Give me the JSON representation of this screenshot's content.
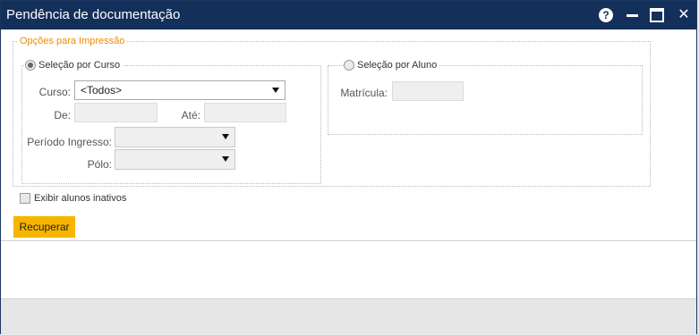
{
  "window": {
    "title": "Pendência de documentação",
    "help_glyph": "?",
    "close_glyph": "✕"
  },
  "options": {
    "legend": "Opções para Impressão",
    "by_course": {
      "label": "Seleção por Curso",
      "selected": true,
      "course_label": "Curso:",
      "course_value": "<Todos>",
      "from_label": "De:",
      "to_label": "Até:",
      "period_label": "Período Ingresso:",
      "pole_label": "Pólo:"
    },
    "by_student": {
      "label": "Seleção por Aluno",
      "selected": false,
      "registration_label": "Matrícula:"
    }
  },
  "inactive": {
    "label": "Exibir alunos inativos",
    "checked": false
  },
  "actions": {
    "retrieve_label": "Recuperar"
  },
  "colors": {
    "titlebar": "#13305b",
    "accent": "#f7b500",
    "legend": "#f08a00"
  }
}
